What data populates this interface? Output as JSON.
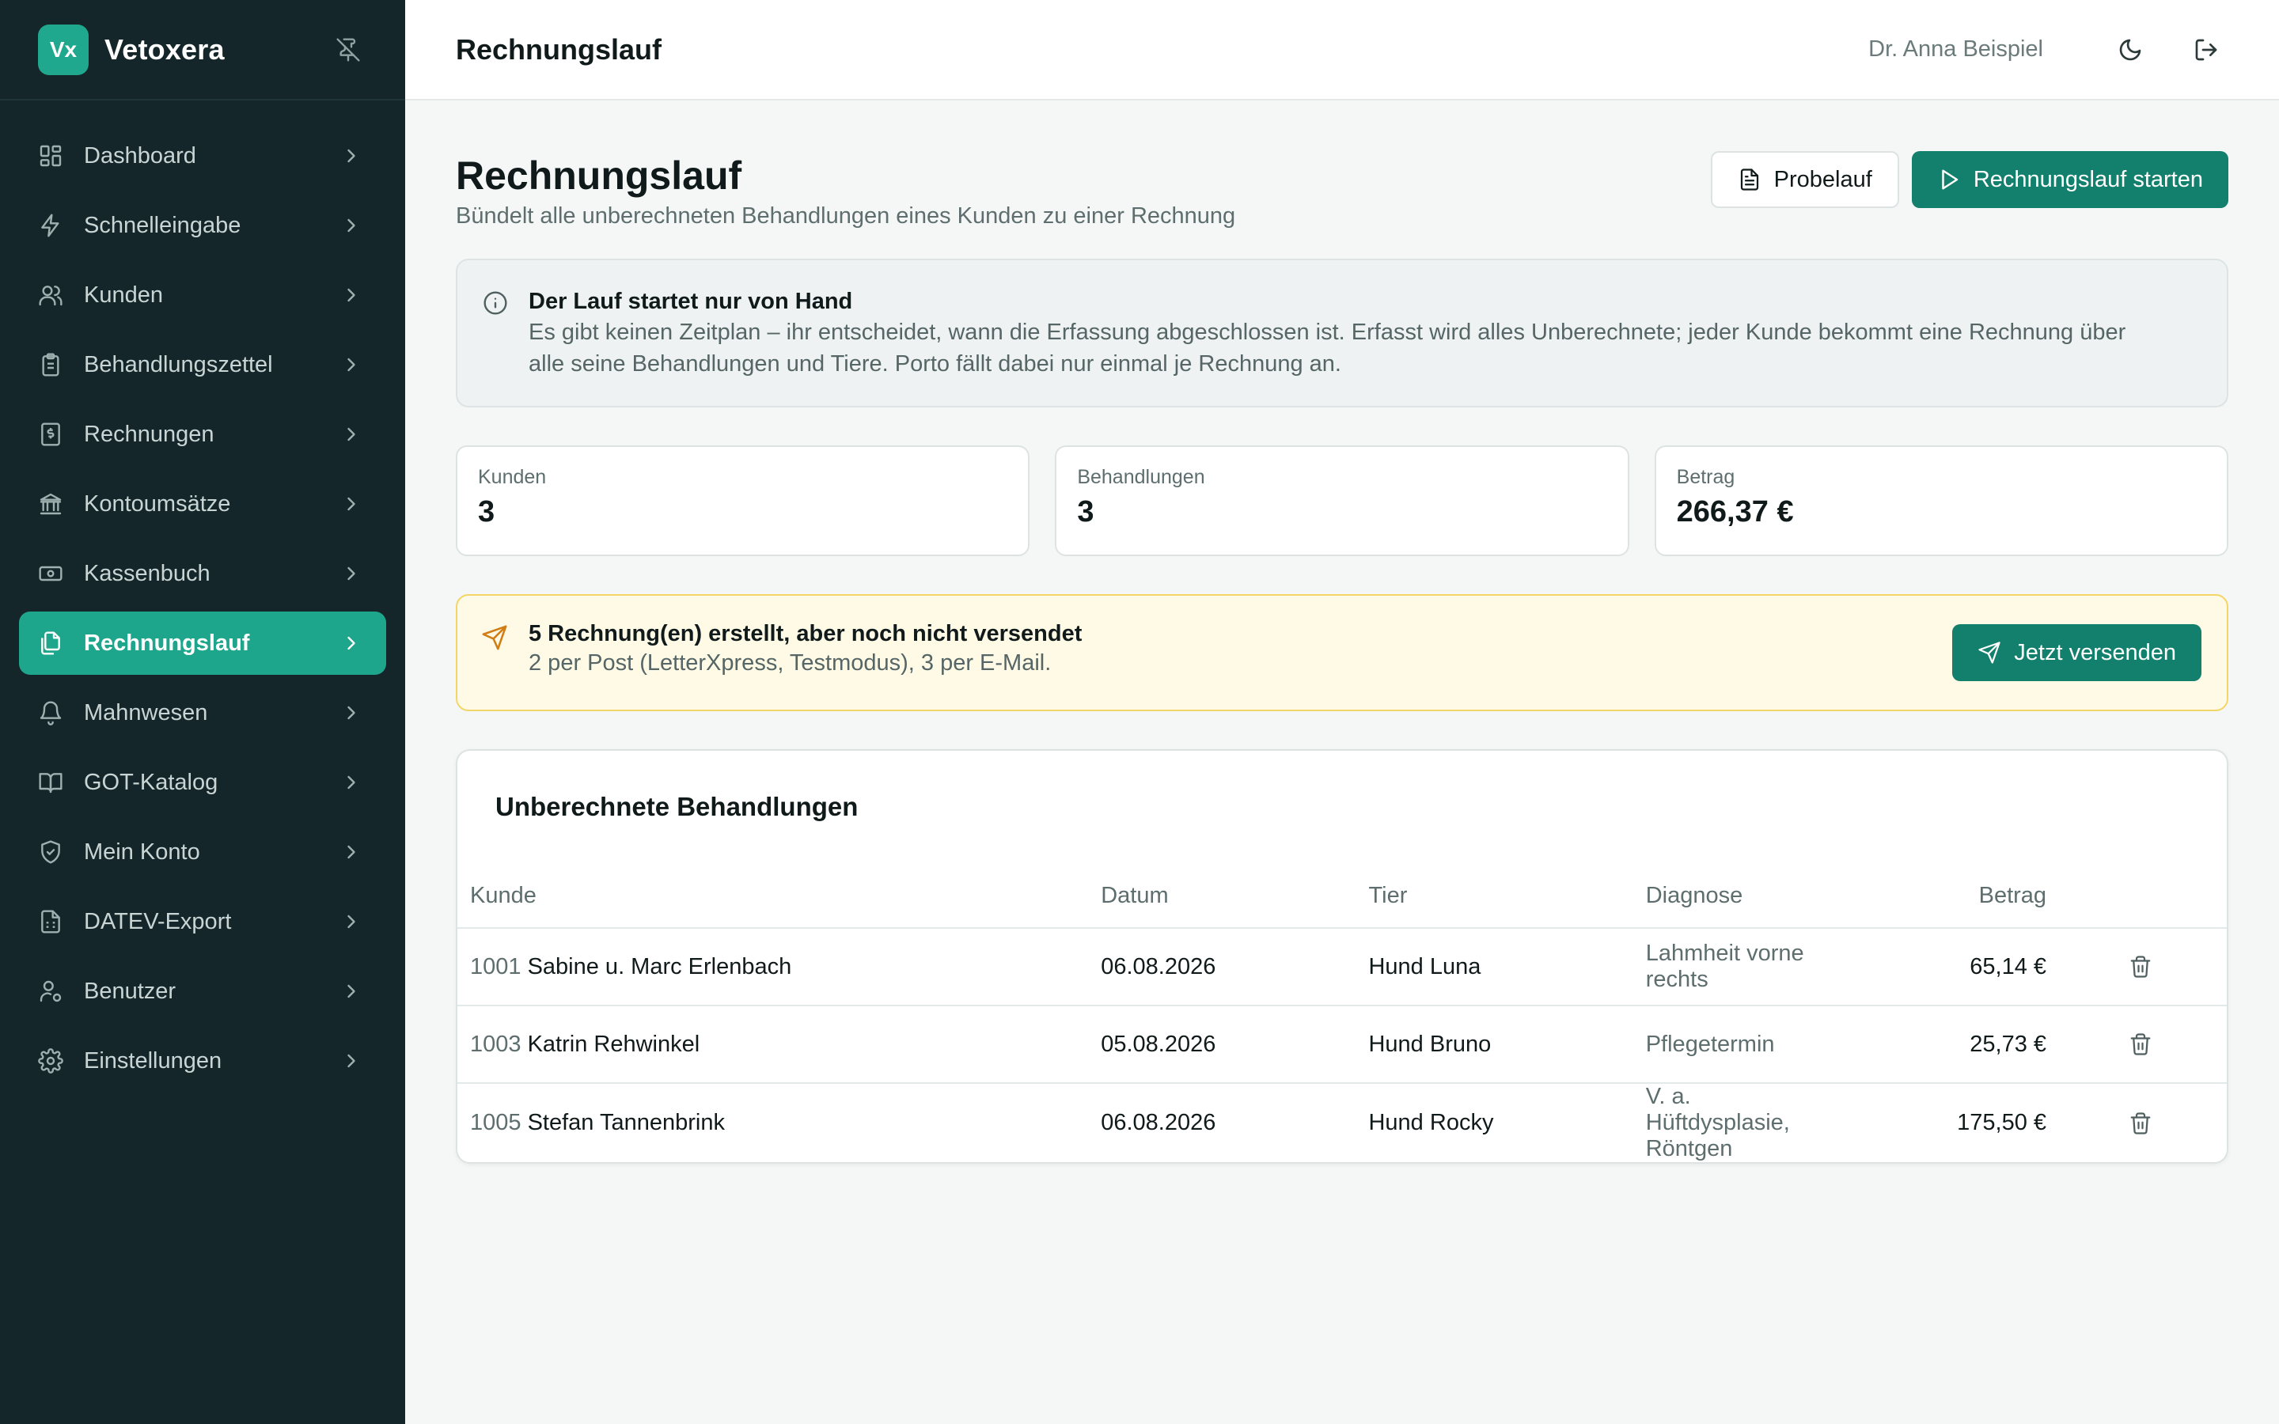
{
  "app": {
    "logo": "Vx",
    "name": "Vetoxera"
  },
  "sidebar": {
    "items": [
      {
        "label": "Dashboard",
        "icon": "dashboard-icon"
      },
      {
        "label": "Schnelleingabe",
        "icon": "lightning-icon"
      },
      {
        "label": "Kunden",
        "icon": "users-icon"
      },
      {
        "label": "Behandlungszettel",
        "icon": "clipboard-icon"
      },
      {
        "label": "Rechnungen",
        "icon": "invoice-icon"
      },
      {
        "label": "Kontoumsätze",
        "icon": "bank-icon"
      },
      {
        "label": "Kassenbuch",
        "icon": "cash-icon"
      },
      {
        "label": "Rechnungslauf",
        "icon": "documents-icon",
        "active": true
      },
      {
        "label": "Mahnwesen",
        "icon": "bell-icon"
      },
      {
        "label": "GOT-Katalog",
        "icon": "book-icon"
      },
      {
        "label": "Mein Konto",
        "icon": "shield-icon"
      },
      {
        "label": "DATEV-Export",
        "icon": "spreadsheet-icon"
      },
      {
        "label": "Benutzer",
        "icon": "user-gear-icon"
      },
      {
        "label": "Einstellungen",
        "icon": "gear-icon"
      }
    ]
  },
  "topbar": {
    "title": "Rechnungslauf",
    "user": "Dr. Anna Beispiel"
  },
  "page": {
    "title": "Rechnungslauf",
    "subtitle": "Bündelt alle unberechneten Behandlungen eines Kunden zu einer Rechnung",
    "probelauf_label": "Probelauf",
    "start_label": "Rechnungslauf starten"
  },
  "info": {
    "title": "Der Lauf startet nur von Hand",
    "text": "Es gibt keinen Zeitplan – ihr entscheidet, wann die Erfassung abgeschlossen ist. Erfasst wird alles Unberechnete; jeder Kunde bekommt eine Rechnung über alle seine Behandlungen und Tiere. Porto fällt dabei nur einmal je Rechnung an."
  },
  "stats": [
    {
      "label": "Kunden",
      "value": "3"
    },
    {
      "label": "Behandlungen",
      "value": "3"
    },
    {
      "label": "Betrag",
      "value": "266,37 €"
    }
  ],
  "notice": {
    "title": "5 Rechnung(en) erstellt, aber noch nicht versendet",
    "text": "2 per Post (LetterXpress, Testmodus), 3 per E-Mail.",
    "button": "Jetzt versenden"
  },
  "table": {
    "title": "Unberechnete Behandlungen",
    "headers": {
      "kunde": "Kunde",
      "datum": "Datum",
      "tier": "Tier",
      "diagnose": "Diagnose",
      "betrag": "Betrag"
    },
    "rows": [
      {
        "id": "1001",
        "name": "Sabine u. Marc Erlenbach",
        "datum": "06.08.2026",
        "tier": "Hund Luna",
        "diagnose": "Lahmheit vorne rechts",
        "betrag": "65,14 €"
      },
      {
        "id": "1003",
        "name": "Katrin Rehwinkel",
        "datum": "05.08.2026",
        "tier": "Hund Bruno",
        "diagnose": "Pflegetermin",
        "betrag": "25,73 €"
      },
      {
        "id": "1005",
        "name": "Stefan Tannenbrink",
        "datum": "06.08.2026",
        "tier": "Hund Rocky",
        "diagnose": "V. a. Hüftdysplasie, Röntgen",
        "betrag": "175,50 €"
      }
    ]
  },
  "colors": {
    "sidebar_bg": "#15262a",
    "accent": "#1ea68c",
    "primary_button": "#13806d",
    "notice_bg": "#fefae6",
    "notice_border": "#f4d568"
  }
}
